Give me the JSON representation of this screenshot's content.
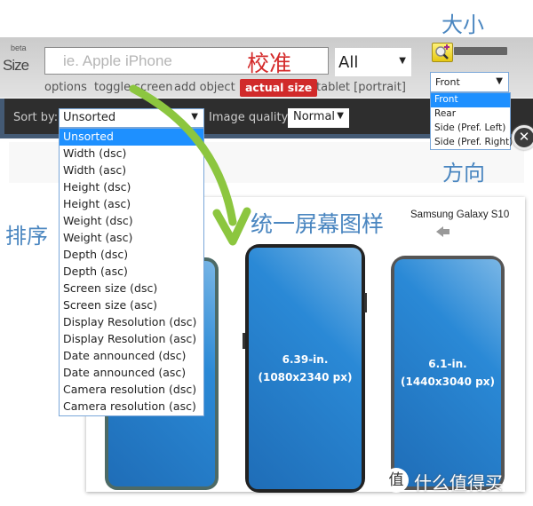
{
  "header": {
    "beta_label": "beta",
    "size_label": "Size",
    "search_placeholder": "ie. Apple iPhone",
    "filter_select": "All",
    "links": [
      "options",
      "toggle screen",
      "add object"
    ],
    "actual_size_button": "actual size",
    "tablet_link": "tablet [portrait]"
  },
  "view_select": {
    "value": "Front",
    "options": [
      "Front",
      "Rear",
      "Side (Pref. Left)",
      "Side (Pref. Right)"
    ],
    "selected_index": 0
  },
  "sortbar": {
    "sort_label": "Sort by:",
    "sort_value": "Unsorted",
    "sort_options": [
      "Unsorted",
      "Width (dsc)",
      "Width (asc)",
      "Height (dsc)",
      "Height (asc)",
      "Weight (dsc)",
      "Weight (asc)",
      "Depth (dsc)",
      "Depth (asc)",
      "Screen size (dsc)",
      "Screen size (asc)",
      "Display Resolution (dsc)",
      "Display Resolution (asc)",
      "Date announced (dsc)",
      "Date announced (asc)",
      "Camera resolution (dsc)",
      "Camera resolution (asc)"
    ],
    "quality_label": "Image quality:",
    "quality_value": "Normal"
  },
  "annotations": {
    "calibrate": "校准",
    "size": "大小",
    "direction": "方向",
    "sort": "排序",
    "unified_screen": "统一屏幕图样"
  },
  "compare": {
    "device_name": "Samsung Galaxy S10",
    "phones": [
      {
        "size": "",
        "resolution": ""
      },
      {
        "size": "6.39-in.",
        "resolution": "(1080x2340 px)"
      },
      {
        "size": "6.1-in.",
        "resolution": "(1440x3040 px)"
      }
    ]
  },
  "icons": {
    "close": "✕",
    "dropdown_arrow": "▼"
  },
  "watermark": {
    "logo": "值",
    "text": "什么值得买"
  },
  "colors": {
    "accent_blue": "#1e90ff",
    "actual_size_red": "#d12a2a",
    "annotation_blue": "#4a86c0",
    "annotation_red": "#d42a2a",
    "arrow_green": "#8cc63f"
  }
}
